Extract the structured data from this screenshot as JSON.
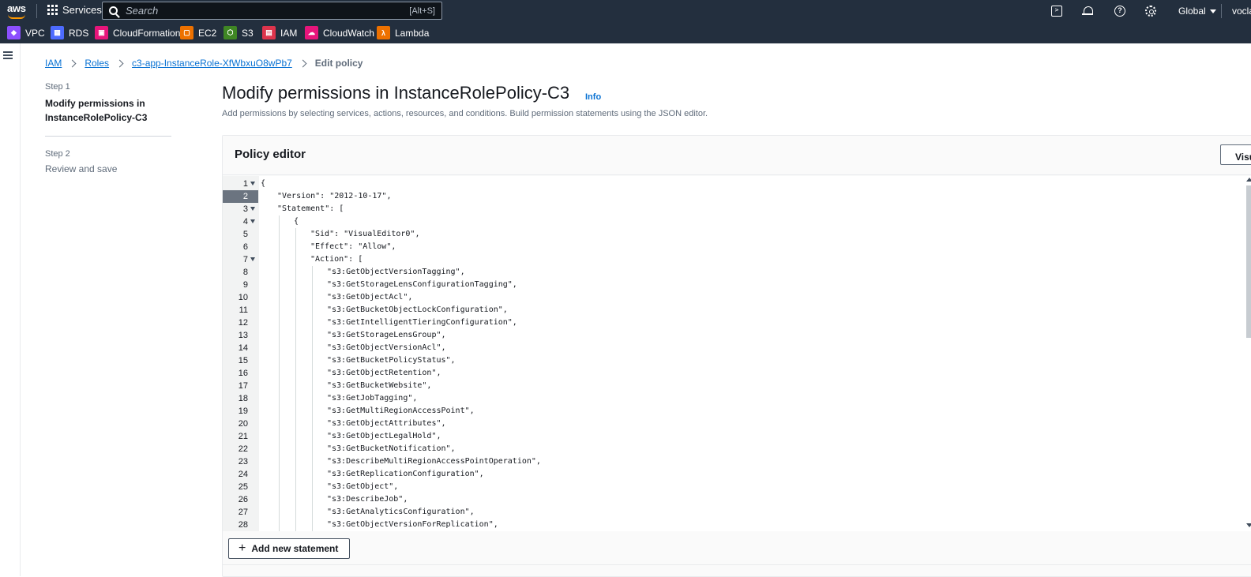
{
  "topnav": {
    "logo": "aws",
    "services_label": "Services",
    "search_placeholder": "Search",
    "search_shortcut": "[Alt+S]",
    "region": "Global",
    "account": "vocla"
  },
  "favorites": [
    {
      "label": "VPC",
      "icon": "vpc-icon",
      "color": "#8c4fff"
    },
    {
      "label": "RDS",
      "icon": "rds-icon",
      "color": "#4d6bfe"
    },
    {
      "label": "CloudFormation",
      "icon": "cloudformation-icon",
      "color": "#e7157b"
    },
    {
      "label": "EC2",
      "icon": "ec2-icon",
      "color": "#ed7100"
    },
    {
      "label": "S3",
      "icon": "s3-icon",
      "color": "#3f8624"
    },
    {
      "label": "IAM",
      "icon": "iam-icon",
      "color": "#dd344c"
    },
    {
      "label": "CloudWatch",
      "icon": "cloudwatch-icon",
      "color": "#e7157b"
    },
    {
      "label": "Lambda",
      "icon": "lambda-icon",
      "color": "#ed7100"
    }
  ],
  "breadcrumb": {
    "items": [
      "IAM",
      "Roles",
      "c3-app-InstanceRole-XfWbxuO8wPb7"
    ],
    "current": "Edit policy"
  },
  "steps": {
    "step1_label": "Step 1",
    "step1_title": "Modify permissions in InstanceRolePolicy-C3",
    "step2_label": "Step 2",
    "step2_title": "Review and save"
  },
  "main": {
    "title": "Modify permissions in InstanceRolePolicy-C3",
    "info": "Info",
    "description": "Add permissions by selecting services, actions, resources, and conditions. Build permission statements using the JSON editor."
  },
  "editor": {
    "title": "Policy editor",
    "visual_button": "Visu",
    "add_statement": "Add new statement",
    "active_line": 2,
    "lines": [
      {
        "n": "1",
        "fold": true,
        "indent": 0,
        "text": "{"
      },
      {
        "n": "2",
        "fold": false,
        "indent": 1,
        "text": "\"Version\": \"2012-10-17\","
      },
      {
        "n": "3",
        "fold": true,
        "indent": 1,
        "text": "\"Statement\": ["
      },
      {
        "n": "4",
        "fold": true,
        "indent": 2,
        "text": "{"
      },
      {
        "n": "5",
        "fold": false,
        "indent": 3,
        "text": "\"Sid\": \"VisualEditor0\","
      },
      {
        "n": "6",
        "fold": false,
        "indent": 3,
        "text": "\"Effect\": \"Allow\","
      },
      {
        "n": "7",
        "fold": true,
        "indent": 3,
        "text": "\"Action\": ["
      },
      {
        "n": "8",
        "fold": false,
        "indent": 4,
        "text": "\"s3:GetObjectVersionTagging\","
      },
      {
        "n": "9",
        "fold": false,
        "indent": 4,
        "text": "\"s3:GetStorageLensConfigurationTagging\","
      },
      {
        "n": "10",
        "fold": false,
        "indent": 4,
        "text": "\"s3:GetObjectAcl\","
      },
      {
        "n": "11",
        "fold": false,
        "indent": 4,
        "text": "\"s3:GetBucketObjectLockConfiguration\","
      },
      {
        "n": "12",
        "fold": false,
        "indent": 4,
        "text": "\"s3:GetIntelligentTieringConfiguration\","
      },
      {
        "n": "13",
        "fold": false,
        "indent": 4,
        "text": "\"s3:GetStorageLensGroup\","
      },
      {
        "n": "14",
        "fold": false,
        "indent": 4,
        "text": "\"s3:GetObjectVersionAcl\","
      },
      {
        "n": "15",
        "fold": false,
        "indent": 4,
        "text": "\"s3:GetBucketPolicyStatus\","
      },
      {
        "n": "16",
        "fold": false,
        "indent": 4,
        "text": "\"s3:GetObjectRetention\","
      },
      {
        "n": "17",
        "fold": false,
        "indent": 4,
        "text": "\"s3:GetBucketWebsite\","
      },
      {
        "n": "18",
        "fold": false,
        "indent": 4,
        "text": "\"s3:GetJobTagging\","
      },
      {
        "n": "19",
        "fold": false,
        "indent": 4,
        "text": "\"s3:GetMultiRegionAccessPoint\","
      },
      {
        "n": "20",
        "fold": false,
        "indent": 4,
        "text": "\"s3:GetObjectAttributes\","
      },
      {
        "n": "21",
        "fold": false,
        "indent": 4,
        "text": "\"s3:GetObjectLegalHold\","
      },
      {
        "n": "22",
        "fold": false,
        "indent": 4,
        "text": "\"s3:GetBucketNotification\","
      },
      {
        "n": "23",
        "fold": false,
        "indent": 4,
        "text": "\"s3:DescribeMultiRegionAccessPointOperation\","
      },
      {
        "n": "24",
        "fold": false,
        "indent": 4,
        "text": "\"s3:GetReplicationConfiguration\","
      },
      {
        "n": "25",
        "fold": false,
        "indent": 4,
        "text": "\"s3:GetObject\","
      },
      {
        "n": "26",
        "fold": false,
        "indent": 4,
        "text": "\"s3:DescribeJob\","
      },
      {
        "n": "27",
        "fold": false,
        "indent": 4,
        "text": "\"s3:GetAnalyticsConfiguration\","
      },
      {
        "n": "28",
        "fold": false,
        "indent": 4,
        "text": "\"s3:GetObjectVersionForReplication\","
      }
    ]
  },
  "colors": {
    "nav_bg": "#232f3e",
    "link": "#0972d3",
    "text_secondary": "#5f6b7a"
  }
}
